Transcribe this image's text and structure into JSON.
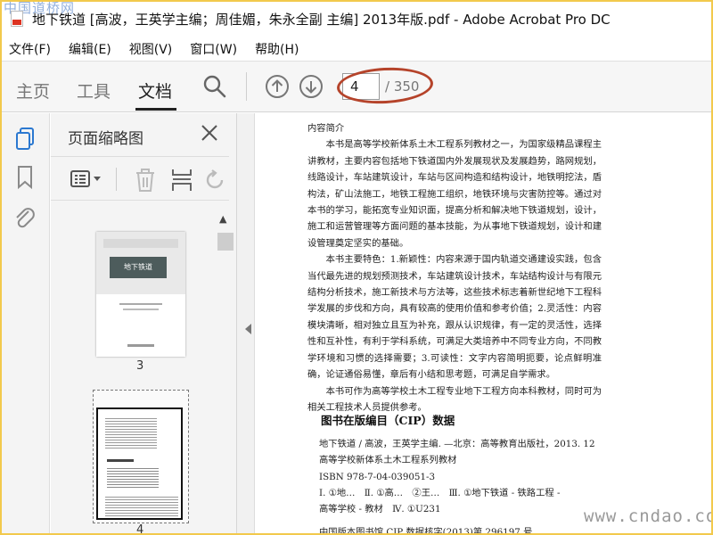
{
  "watermark_top": "中国道桥网",
  "window": {
    "title": "地下铁道 [高波，王英学主编；周佳媚，朱永全副 主编] 2013年版.pdf - Adobe Acrobat Pro DC"
  },
  "menu": [
    {
      "label": "文件(F)"
    },
    {
      "label": "编辑(E)"
    },
    {
      "label": "视图(V)"
    },
    {
      "label": "窗口(W)"
    },
    {
      "label": "帮助(H)"
    }
  ],
  "toolbar": {
    "tabs": [
      {
        "label": "主页",
        "active": false
      },
      {
        "label": "工具",
        "active": false
      },
      {
        "label": "文档",
        "active": true
      }
    ],
    "current_page": "4",
    "total_pages": "/ 350"
  },
  "thumbnails": {
    "title": "页面缩略图",
    "pages": [
      {
        "label": "3",
        "cover_title": "地下铁道"
      },
      {
        "label": "4",
        "selected": true
      }
    ]
  },
  "document": {
    "heading": "内容简介",
    "paragraphs": [
      "本书是高等学校新体系土木工程系列教材之一，为国家级精品课程主讲教材，主要内容包括地下铁道国内外发展现状及发展趋势，路网规划，线路设计，车站建筑设计，车站与区间构造和结构设计，地铁明挖法，盾构法，矿山法施工，地铁工程施工组织，地铁环境与灾害防控等。通过对本书的学习，能拓宽专业知识面，提高分析和解决地下铁道规划，设计，施工和运营管理等方面问题的基本技能，为从事地下铁道规划，设计和建设管理奠定坚实的基础。",
      "本书主要特色：1.新颖性：内容来源于国内轨道交通建设实践，包含当代最先进的规划预测技术，车站建筑设计技术，车站结构设计与有限元结构分析技术，施工新技术与方法等，这些技术标志着新世纪地下工程科学发展的步伐和方向，具有较高的使用价值和参考价值；2.灵活性：内容模块清晰，相对独立且互为补充，跟从认识规律，有一定的灵活性，选择性和互补性，有利于学科系统，可满足大类培养中不同专业方向，不同教学环境和习惯的选择需要；3.可读性：文字内容简明扼要，论点鲜明准确，论证通俗易懂，章后有小结和思考题，可满足自学需求。",
      "本书可作为高等学校土木工程专业地下工程方向本科教材，同时可为相关工程技术人员提供参考。"
    ],
    "cip_title": "图书在版编目（CIP）数据",
    "cip_lines": [
      "地下铁道 / 高波，王英学主编. —北京：高等教育出版社，2013. 12",
      "高等学校新体系土木工程系列教材",
      "ISBN 978-7-04-039051-3",
      "Ⅰ. ①地…　Ⅱ. ①高…　②王…　Ⅲ. ①地下铁道 - 铁路工程 -",
      "高等学校 - 教材　Ⅳ. ①U231",
      "",
      "中国版本图书馆 CIP 数据核字(2013)第 296197 号"
    ]
  },
  "watermark_bottom": "www.cndao.com",
  "colors": {
    "annotation_ellipse": "#b5432a",
    "frame": "#f2c94c"
  }
}
